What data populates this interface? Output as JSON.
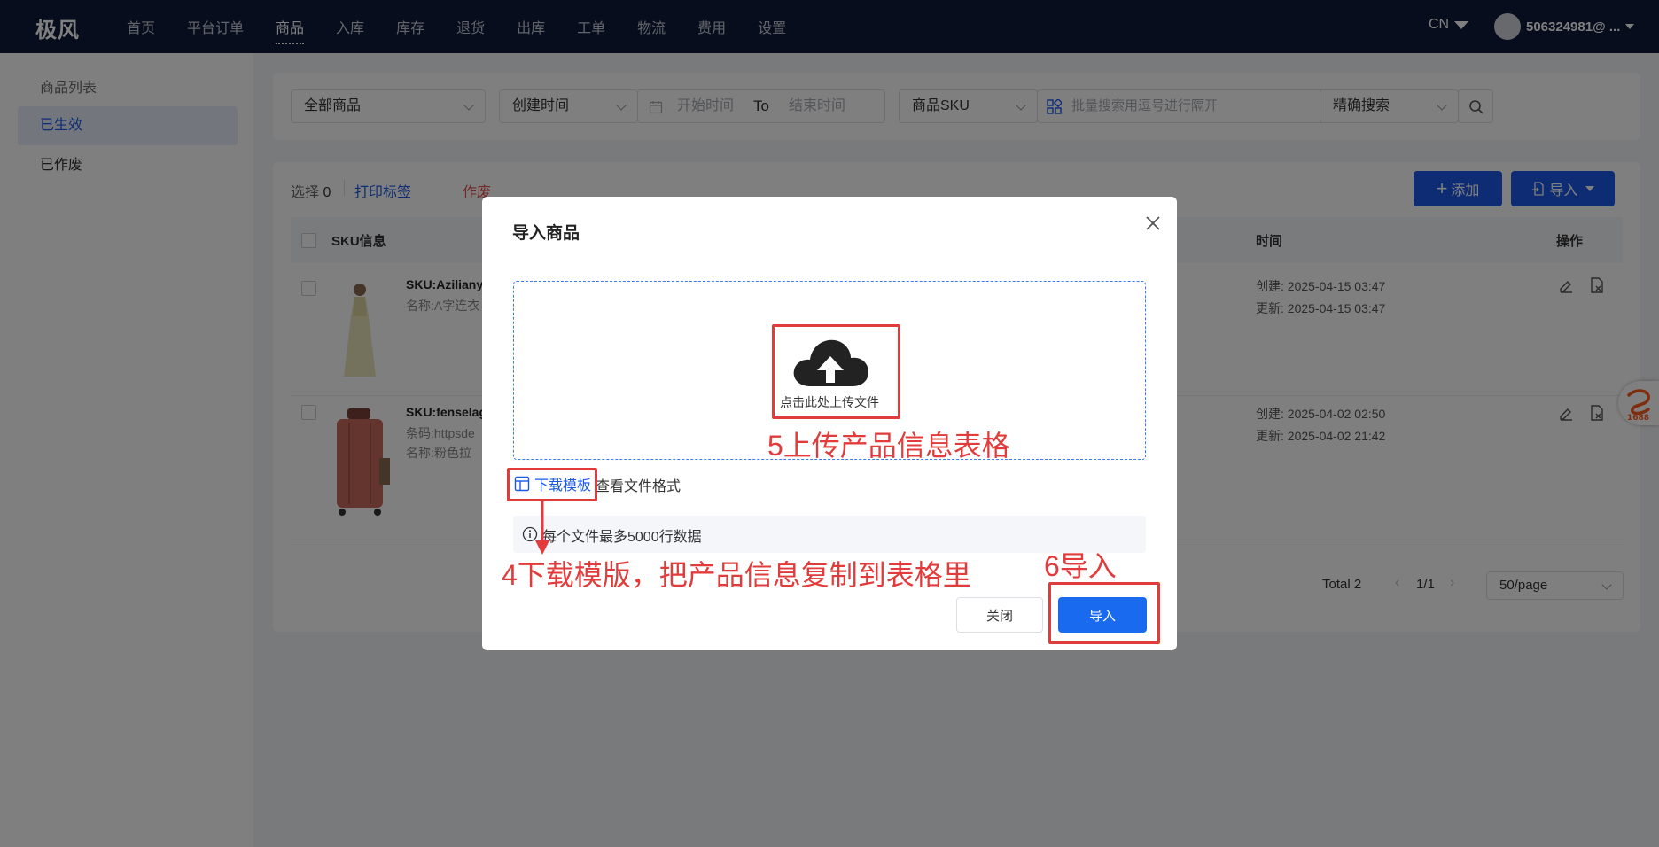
{
  "app": {
    "logo": "极风"
  },
  "nav": {
    "items": [
      "首页",
      "平台订单",
      "商品",
      "入库",
      "库存",
      "退货",
      "出库",
      "工单",
      "物流",
      "费用",
      "设置"
    ],
    "active": "商品",
    "lang": "CN",
    "user": "506324981@ ..."
  },
  "sidebar": {
    "items": [
      "商品列表",
      "已生效",
      "已作废"
    ],
    "active": "已生效"
  },
  "filter": {
    "scope": "全部商品",
    "time_type": "创建时间",
    "start_placeholder": "开始时间",
    "to": "To",
    "end_placeholder": "结束时间",
    "field": "商品SKU",
    "search_placeholder": "批量搜索用逗号进行隔开",
    "mode": "精确搜索"
  },
  "toolbar": {
    "select_label": "选择",
    "select_count": "0",
    "print": "打印标签",
    "void": "作废",
    "add": "添加",
    "import": "导入"
  },
  "table": {
    "headers": {
      "sku": "SKU信息",
      "time": "时间",
      "action": "操作"
    },
    "rows": [
      {
        "sku": "SKU:Aziliany",
        "line2": "名称:A字连衣",
        "line3": "",
        "created": "创建: 2025-04-15 03:47",
        "updated": "更新: 2025-04-15 03:47"
      },
      {
        "sku": "SKU:fenselag",
        "line2": "条码:httpsde",
        "line3": "名称:粉色拉",
        "created": "创建: 2025-04-02 02:50",
        "updated": "更新: 2025-04-02 21:42"
      }
    ]
  },
  "pagination": {
    "total": "Total 2",
    "page": "1/1",
    "page_size": "50/page"
  },
  "modal": {
    "title": "导入商品",
    "upload_text": "点击此处上传文件",
    "download_template": "下载模板",
    "view_format": "查看文件格式",
    "info": "每个文件最多5000行数据",
    "close": "关闭",
    "import": "导入"
  },
  "annotations": {
    "step5": "5上传产品信息表格",
    "step4": "4下载模版，把产品信息复制到表格里",
    "step6": "6导入"
  },
  "badge": "1688",
  "colors": {
    "primary": "#1a58e6",
    "nav_bg": "#0e1a3a",
    "annotation": "#e23b3b"
  }
}
